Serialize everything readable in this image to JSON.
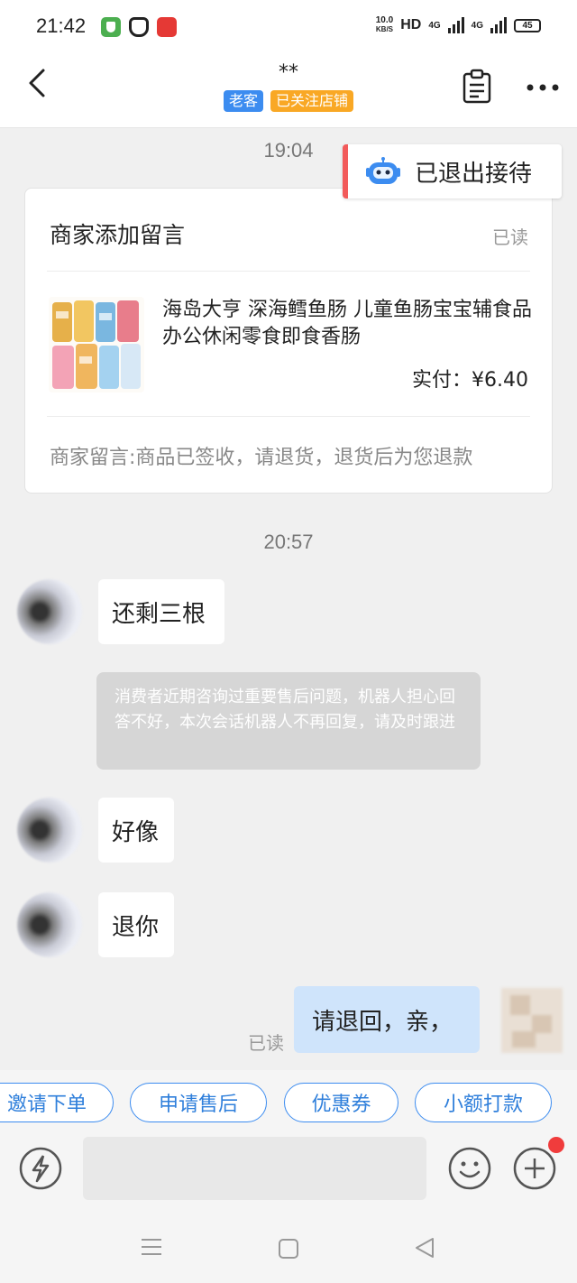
{
  "status_bar": {
    "time": "21:42",
    "speed_value": "10.0",
    "speed_unit": "KB/S",
    "hd": "HD",
    "net1": "4G",
    "net2": "4G",
    "battery": "45"
  },
  "header": {
    "title": "**",
    "tags": [
      "老客",
      "已关注店铺"
    ]
  },
  "chat": {
    "timestamp_1": "19:04",
    "exit_notice": "已退出接待",
    "merchant_card": {
      "title": "商家添加留言",
      "read_status": "已读",
      "product_name": "海岛大亨 深海鳕鱼肠 儿童鱼肠宝宝辅食品办公休闲零食即食香肠",
      "price": "实付：¥6.40",
      "note": "商家留言:商品已签收，请退货，退货后为您退款"
    },
    "timestamp_2": "20:57",
    "messages_in": [
      "还剩三根",
      "好像",
      "退你"
    ],
    "system_message": "消费者近期咨询过重要售后问题，机器人担心回答不好，本次会话机器人不再回复，请及时跟进",
    "message_out": "请退回，亲，",
    "out_read_status": "已读"
  },
  "quick_actions": [
    "邀请下单",
    "申请售后",
    "优惠券",
    "小额打款"
  ],
  "input": {
    "placeholder": ""
  }
}
